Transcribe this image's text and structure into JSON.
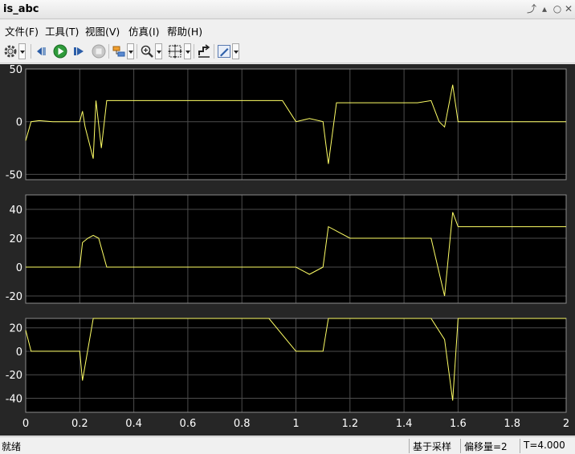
{
  "window": {
    "title": "is_abc",
    "buttons": [
      "pin-icon",
      "undock-icon",
      "minimize-icon",
      "close-icon"
    ]
  },
  "menu": {
    "items": [
      "文件(F)",
      "工具(T)",
      "视图(V)",
      "仿真(I)",
      "帮助(H)"
    ]
  },
  "toolbar": {
    "icons": [
      "gear-icon",
      "step-back-icon",
      "run-icon",
      "step-forward-icon",
      "stop-icon",
      "highlight-icon",
      "zoom-icon",
      "autoscale-icon",
      "cursor-icon",
      "style-icon"
    ]
  },
  "colors": {
    "trace": "#ffff66",
    "axes_bg": "#000000",
    "figure_bg": "#262626",
    "grid": "#4d4d4d",
    "tick_label": "#ffffff"
  },
  "chart_data": [
    {
      "type": "line",
      "ylim": [
        -55,
        50
      ],
      "ytick_labels": [
        "50",
        "0",
        "-50"
      ],
      "xlim": [
        0,
        2
      ],
      "grid": true,
      "series": [
        {
          "description": "current, steady ≈0 until 0.2, switching spikes ±20 from 0.2 to 1.0, ≈0 from 1.0 to 1.12, spikes from 1.12 to 1.5, transient to ≈35 near 1.58, ≈0 after",
          "x": [
            0,
            0.02,
            0.05,
            0.1,
            0.15,
            0.2,
            0.21,
            0.22,
            0.25,
            0.26,
            0.28,
            0.3,
            0.35,
            0.4,
            0.45,
            0.5,
            0.55,
            0.6,
            0.65,
            0.7,
            0.75,
            0.8,
            0.85,
            0.9,
            0.95,
            1.0,
            1.05,
            1.1,
            1.12,
            1.15,
            1.2,
            1.25,
            1.3,
            1.35,
            1.4,
            1.45,
            1.5,
            1.53,
            1.55,
            1.58,
            1.6,
            1.7,
            1.8,
            1.9,
            2.0
          ],
          "y": [
            -18,
            0,
            1,
            0,
            0,
            0,
            10,
            -5,
            -35,
            20,
            -25,
            20,
            20,
            20,
            20,
            20,
            20,
            20,
            20,
            20,
            20,
            20,
            20,
            20,
            20,
            0,
            3,
            0,
            -40,
            18,
            18,
            18,
            18,
            18,
            18,
            18,
            20,
            0,
            -5,
            35,
            0,
            0,
            0,
            0,
            0
          ]
        }
      ]
    },
    {
      "type": "line",
      "ylim": [
        -25,
        50
      ],
      "ytick_labels": [
        "40",
        "20",
        "0",
        "-20"
      ],
      "xlim": [
        0,
        2
      ],
      "grid": true,
      "series": [
        {
          "description": "≈0 until 0.2, small spikes to ~22 near 0.22–0.27, ≈0 until 1.12, spikes to ~20 from 1.12 to 1.55, large oscillation ±28 from 1.58 to 2.0",
          "x": [
            0,
            0.05,
            0.1,
            0.15,
            0.2,
            0.21,
            0.23,
            0.25,
            0.27,
            0.3,
            0.5,
            0.7,
            0.9,
            1.0,
            1.05,
            1.1,
            1.12,
            1.2,
            1.3,
            1.4,
            1.5,
            1.55,
            1.58,
            1.6,
            1.7,
            1.8,
            1.9,
            2.0
          ],
          "y": [
            0,
            0,
            0,
            0,
            0,
            17,
            20,
            22,
            20,
            0,
            0,
            0,
            0,
            0,
            -5,
            0,
            28,
            20,
            20,
            20,
            20,
            -20,
            38,
            28,
            28,
            28,
            28,
            28
          ]
        }
      ]
    },
    {
      "type": "line",
      "ylim": [
        -52,
        28
      ],
      "ytick_labels": [
        "20",
        "0",
        "-20",
        "-40"
      ],
      "xlim": [
        0,
        2
      ],
      "grid": true,
      "xtick_labels": [
        "0",
        "0.2",
        "0.4",
        "0.6",
        "0.8",
        "1",
        "1.2",
        "1.4",
        "1.6",
        "1.8",
        "2"
      ],
      "series": [
        {
          "description": "≈0 until 0.2, saturated switching ±28 from 0.22 to 1.0, ≈0 from 1.0 to 1.12, switching ±28 from 1.12 to 1.5, transient ≈-40 near 1.58, switching ±28 to 2.0",
          "x": [
            0,
            0.02,
            0.05,
            0.1,
            0.15,
            0.2,
            0.21,
            0.25,
            0.3,
            0.4,
            0.5,
            0.6,
            0.7,
            0.8,
            0.9,
            1.0,
            1.05,
            1.1,
            1.12,
            1.2,
            1.3,
            1.4,
            1.5,
            1.55,
            1.58,
            1.6,
            1.7,
            1.8,
            1.9,
            2.0
          ],
          "y": [
            18,
            0,
            0,
            0,
            0,
            0,
            -25,
            28,
            28,
            28,
            28,
            28,
            28,
            28,
            28,
            0,
            0,
            0,
            28,
            28,
            28,
            28,
            28,
            10,
            -42,
            28,
            28,
            28,
            28,
            28
          ]
        }
      ]
    }
  ],
  "status": {
    "ready": "就绪",
    "sample_mode": "基于采样",
    "offset": "偏移量=2",
    "time": "T=4.000"
  }
}
